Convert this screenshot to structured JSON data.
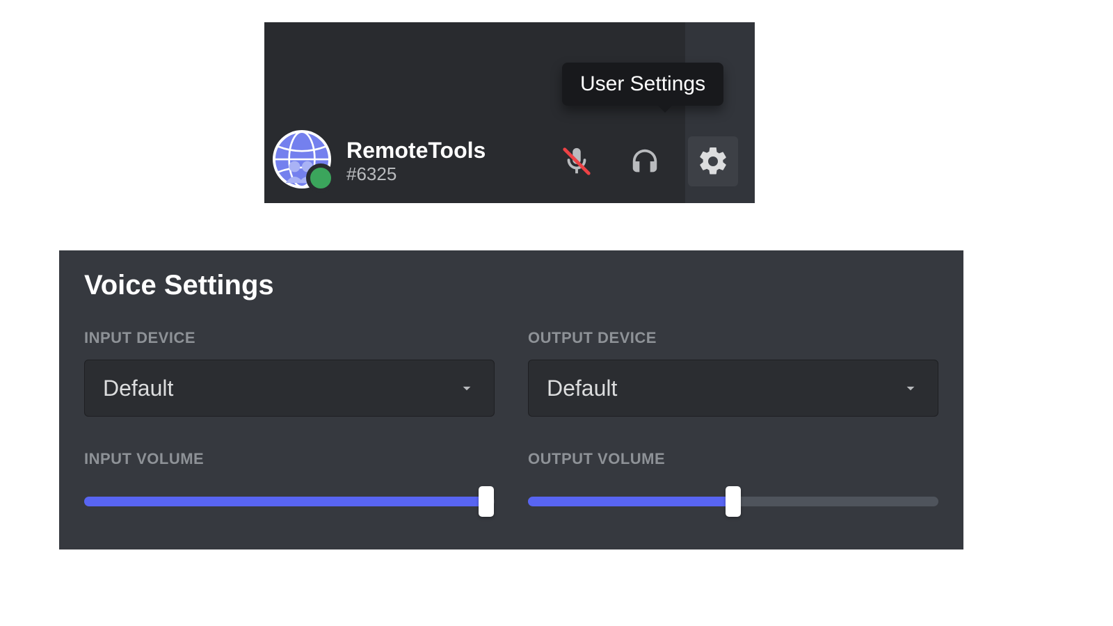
{
  "tooltip": {
    "user_settings": "User Settings"
  },
  "user": {
    "name": "RemoteTools",
    "discriminator": "#6325",
    "status": "online"
  },
  "icons": {
    "mic": "microphone-muted-icon",
    "headphones": "headphones-icon",
    "gear": "gear-icon"
  },
  "voice": {
    "title": "Voice Settings",
    "input_device": {
      "label": "INPUT DEVICE",
      "value": "Default"
    },
    "output_device": {
      "label": "OUTPUT DEVICE",
      "value": "Default"
    },
    "input_volume": {
      "label": "INPUT VOLUME",
      "percent": 98
    },
    "output_volume": {
      "label": "OUTPUT VOLUME",
      "percent": 50
    }
  },
  "colors": {
    "accent": "#5865f2",
    "online": "#3ba55c",
    "panel_bg": "#292b2f",
    "card_bg": "#36393f",
    "input_bg": "#2b2d31",
    "track": "#4f545c",
    "tooltip_bg": "#18191c",
    "text_muted": "#8e9297",
    "icon_muted": "#b9bbbe"
  }
}
